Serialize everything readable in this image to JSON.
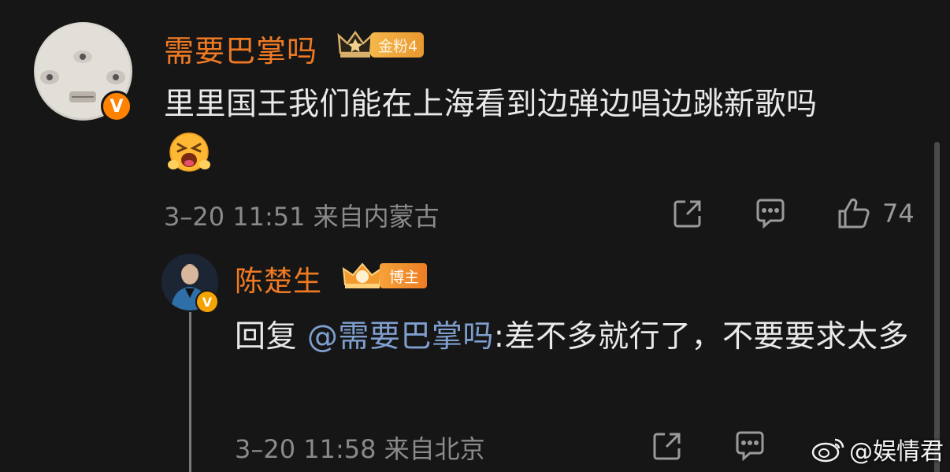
{
  "comment": {
    "username": "需要巴掌吗",
    "fan_badge_label": "金粉4",
    "text": "里里国王我们能在上海看到边弹边唱边跳新歌吗",
    "emoji": "scream-emoji",
    "meta": "3–20 11:51 来自内蒙古",
    "like_count": "74",
    "verified_badge": "V"
  },
  "reply": {
    "username": "陈楚生",
    "role_badge_label": "博主",
    "reply_prefix": "回复 ",
    "mention": "@需要巴掌吗",
    "text": ":差不多就行了，不要要求太多",
    "meta": "3–20 11:58 来自北京",
    "verified_badge": "V"
  },
  "watermark": "@娱情君",
  "icons": [
    "share-icon",
    "comment-icon",
    "like-icon",
    "weibo-logo-icon"
  ],
  "colors": {
    "background": "#161616",
    "username": "#f07a24",
    "mention": "#7f9fcf",
    "meta": "#8a8a8a",
    "verified": "#ff8200"
  }
}
